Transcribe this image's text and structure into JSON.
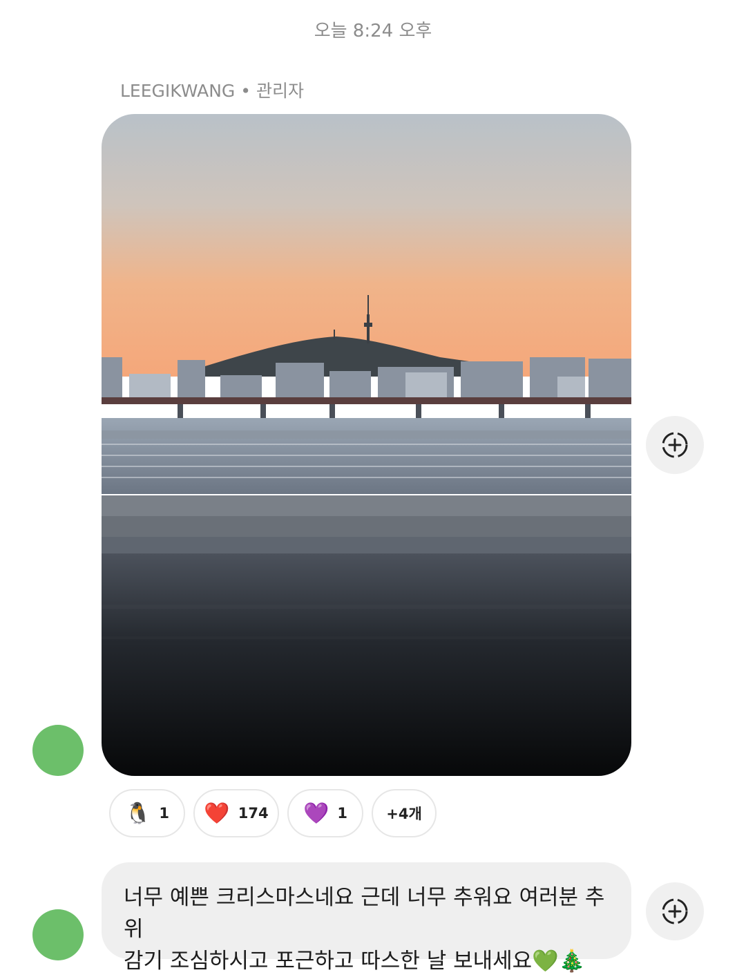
{
  "timestamp": "오늘 8:24 오후",
  "sender": {
    "name": "LEEGIKWANG",
    "separator": "•",
    "role": "관리자"
  },
  "avatar_text": "",
  "photo": {
    "description_icon": "sunset-river-photo"
  },
  "reactions": [
    {
      "emoji": "🐧",
      "count": "1"
    },
    {
      "emoji": "❤️",
      "count": "174"
    },
    {
      "emoji": "💜",
      "count": "1"
    },
    {
      "more_label": "+4개"
    }
  ],
  "message": {
    "line1": "너무 예쁜 크리스마스네요 근데 너무 추워요 여러분 추위",
    "line2": "감기 조심하시고 포근하고 따스한 날 보내세요💚🎄"
  },
  "icons": {
    "add_reaction": "add-reaction-icon"
  },
  "colors": {
    "avatar": "#6cbf6a",
    "bubble": "#efefef",
    "meta_text": "#8c8c8c"
  }
}
